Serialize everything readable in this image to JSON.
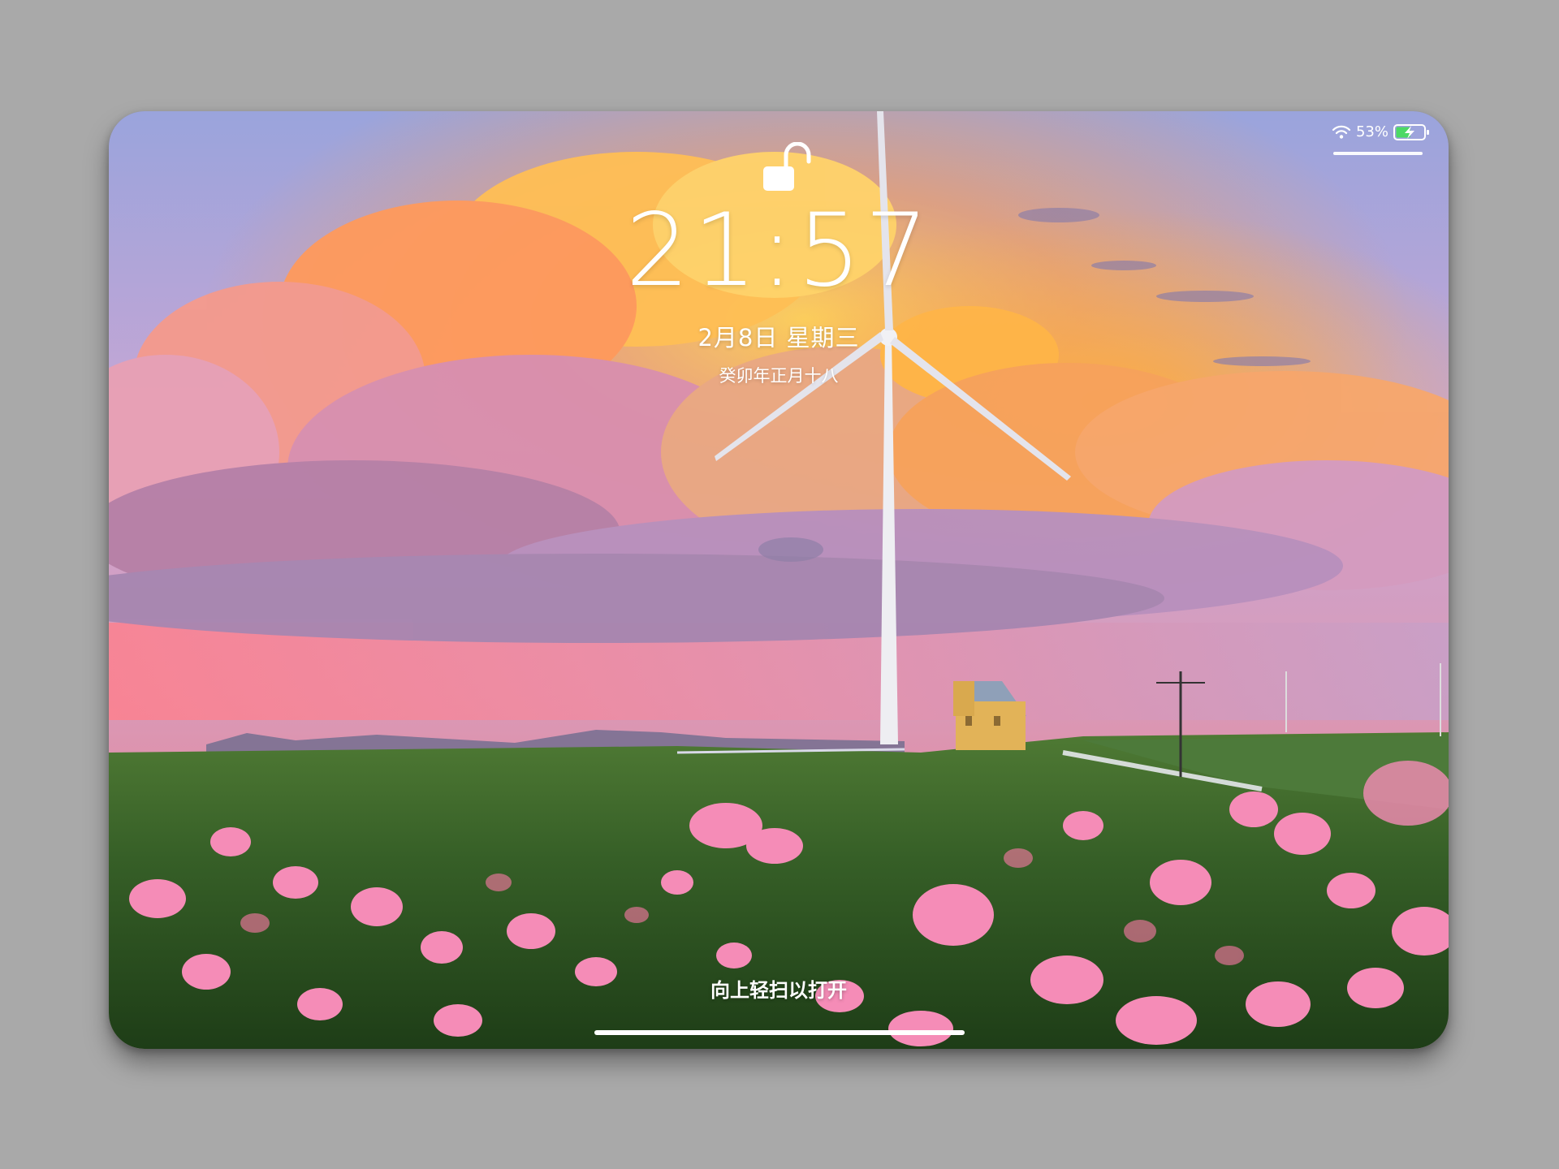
{
  "lockscreen": {
    "time": "21:57",
    "date": "2月8日 星期三",
    "lunar_date": "癸卯年正月十八",
    "swipe_hint": "向上轻扫以打开"
  },
  "status_bar": {
    "battery_percent": "53%",
    "battery_level": 0.53,
    "charging": true,
    "wifi_icon": "wifi-icon",
    "battery_icon": "battery-charging-icon"
  },
  "icons": {
    "lock": "unlocked-padlock-icon"
  },
  "colors": {
    "text": "#ffffff",
    "sky_top": "#8f9fd6",
    "cloud_orange": "#ffb347",
    "cloud_pink": "#e79ab8",
    "grass": "#3f6b2c",
    "flower_pink": "#f58cb7",
    "house": "#e0b050"
  }
}
